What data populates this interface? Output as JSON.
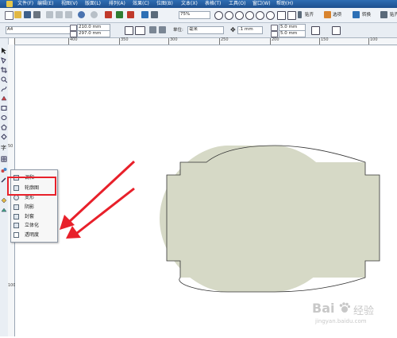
{
  "menubar": {
    "items": [
      "文件(F)",
      "编辑(E)",
      "视图(V)",
      "版面(L)",
      "排列(A)",
      "效果(C)",
      "位图(B)",
      "文本(X)",
      "表格(T)",
      "工具(O)",
      "窗口(W)",
      "帮助(H)"
    ]
  },
  "toolbar": {
    "zoom": "75%",
    "snap_label": "贴齐",
    "launch_label": "启动",
    "options_label": "选项",
    "convert_label": "转换",
    "scale_label": "贴齐"
  },
  "property_bar": {
    "page_size": "A4",
    "width": "210.0 mm",
    "height": "297.0 mm",
    "units_label": "单位:",
    "units_value": "毫米",
    "nudge": ".1 mm",
    "dup_x": "5.0 mm",
    "dup_y": "5.0 mm"
  },
  "ruler": {
    "top_labels": [
      "400",
      "350",
      "300",
      "250",
      "200",
      "150",
      "100",
      "50",
      "0"
    ],
    "left_labels": [
      "50",
      "100"
    ]
  },
  "popup_menu": {
    "items": [
      "调和",
      "轮廓图",
      "变形",
      "阴影",
      "封套",
      "立体化",
      "透明度"
    ]
  },
  "watermark": {
    "brand": "Bai",
    "brand_suffix": "经验",
    "url": "jingyan.baidu.com"
  },
  "colors": {
    "shape_fill": "#d6d9c6",
    "shape_stroke": "#333333",
    "arrow_red": "#e8202a",
    "menubar_bg": "#2461a8"
  }
}
